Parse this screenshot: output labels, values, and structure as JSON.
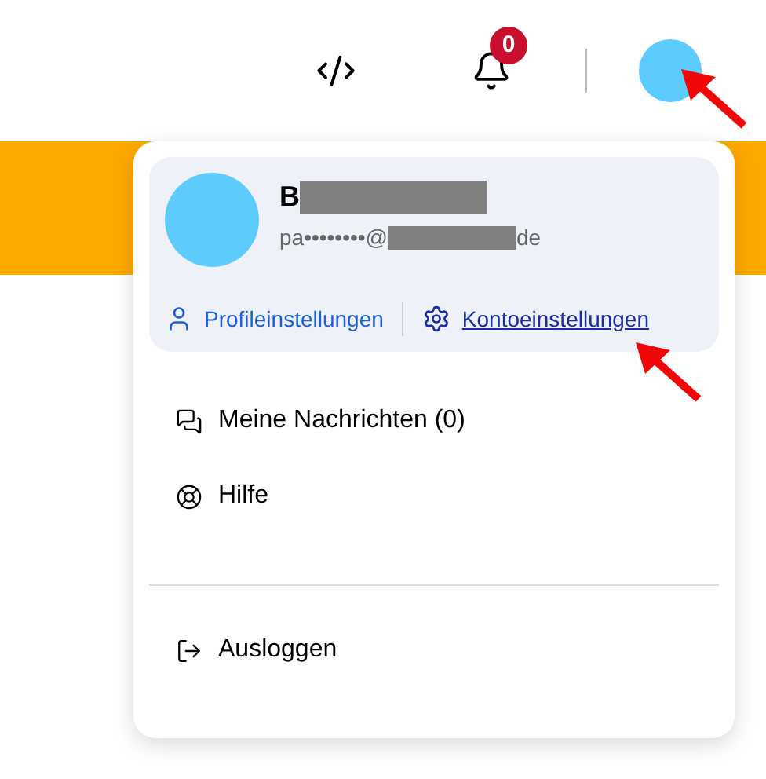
{
  "header": {
    "notification_count": "0"
  },
  "profile": {
    "name": "B",
    "email_start": "pa••••••••@",
    "email_end": "de",
    "links": [
      {
        "kind": "profile",
        "label": "Profileinstellungen",
        "underlined": false
      },
      {
        "kind": "account",
        "label": "Kontoeinstellungen",
        "underlined": true
      }
    ]
  },
  "menu": [
    {
      "kind": "messages",
      "label": "Meine Nachrichten (0)"
    },
    {
      "kind": "help",
      "label": "Hilfe"
    }
  ],
  "logout": {
    "label": "Ausloggen"
  }
}
